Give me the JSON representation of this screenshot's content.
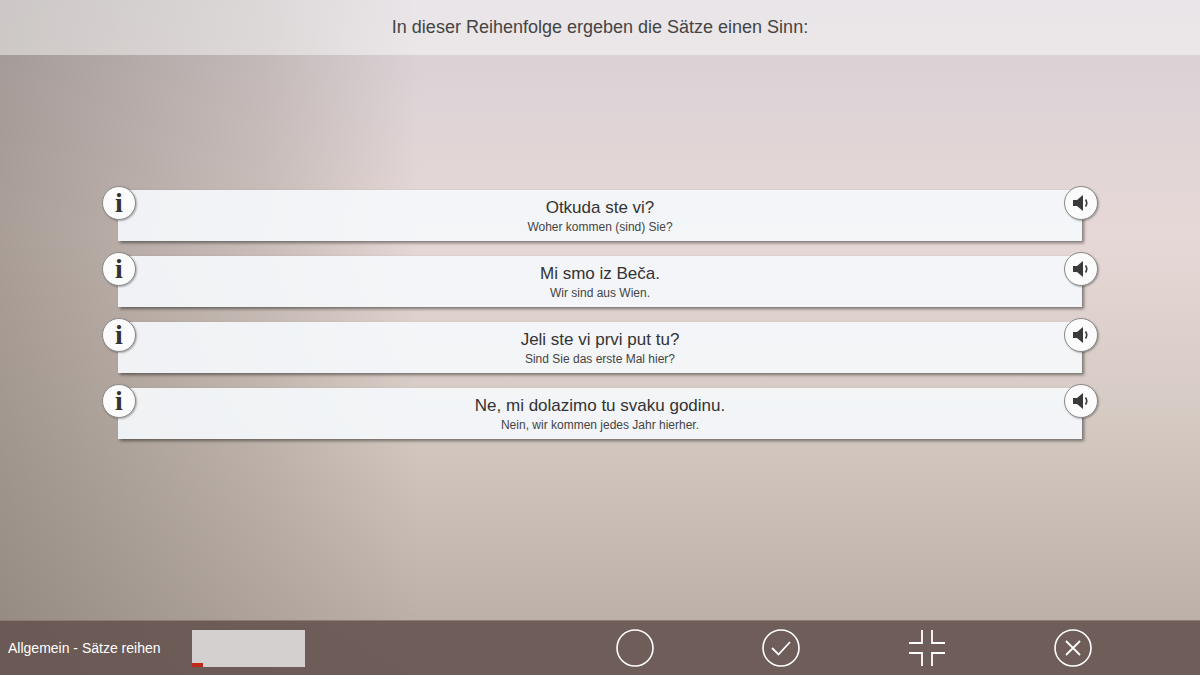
{
  "header": {
    "instruction": "In dieser Reihenfolge ergeben die Sätze einen Sinn:"
  },
  "info_glyph": "i",
  "sentences": [
    {
      "text": "Otkuda ste vi?",
      "translation": "Woher kommen (sind) Sie?"
    },
    {
      "text": "Mi smo iz Beča.",
      "translation": "Wir sind aus Wien."
    },
    {
      "text": "Jeli ste vi prvi put tu?",
      "translation": "Sind Sie das erste Mal hier?"
    },
    {
      "text": "Ne, mi dolazimo tu svaku godinu.",
      "translation": "Nein, wir kommen jedes Jahr hierher."
    }
  ],
  "status_bar": {
    "label": "Allgemein - Sätze reihen",
    "progress": {
      "level": 0.1
    }
  }
}
